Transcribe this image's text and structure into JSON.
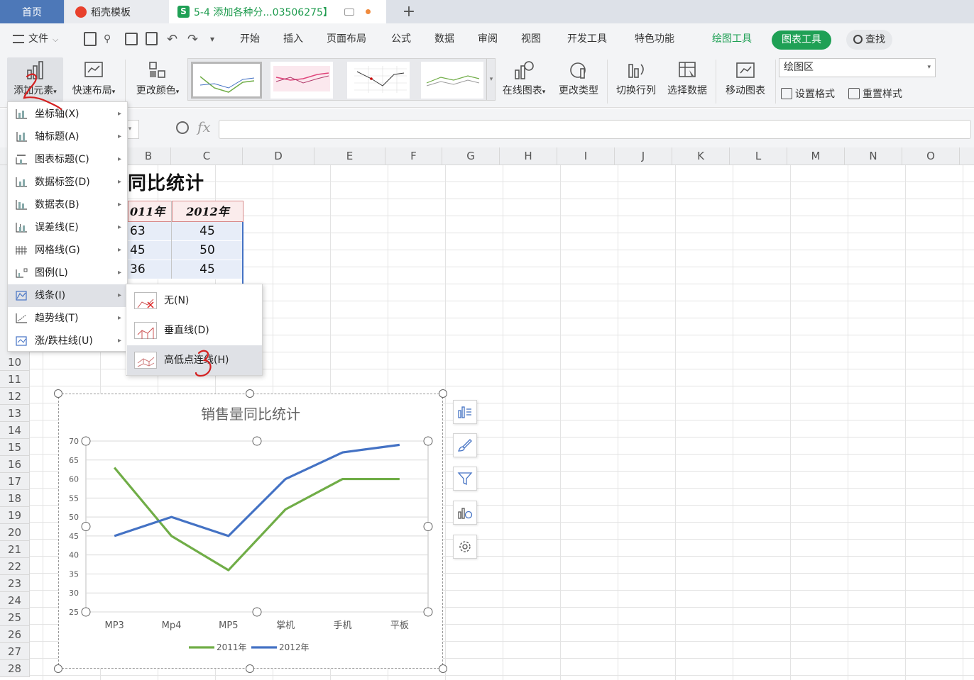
{
  "tabs": {
    "home": "首页",
    "docer": "稻壳模板",
    "file": "5-4 添加各种分...03506275】",
    "file_icon": "S",
    "add": "+"
  },
  "menubar": {
    "file": "文件",
    "items": [
      "开始",
      "插入",
      "页面布局",
      "公式",
      "数据",
      "审阅",
      "视图",
      "开发工具",
      "特色功能"
    ],
    "drawing_tools": "绘图工具",
    "chart_tools": "图表工具",
    "search": "查找"
  },
  "ribbon": {
    "add_element": "添加元素",
    "quick_layout": "快速布局",
    "change_color": "更改颜色",
    "online_chart": "在线图表",
    "change_type": "更改类型",
    "switch_row_col": "切换行列",
    "select_data": "选择数据",
    "move_chart": "移动图表",
    "element_select": "绘图区",
    "set_format": "设置格式",
    "reset_style": "重置样式"
  },
  "formula_bar": {
    "fx": "fx"
  },
  "columns": [
    "B",
    "C",
    "D",
    "E",
    "F",
    "G",
    "H",
    "I",
    "J",
    "K",
    "L",
    "M",
    "N",
    "O"
  ],
  "rows": [
    "10",
    "11",
    "12",
    "13",
    "14",
    "15",
    "16",
    "17",
    "18",
    "19",
    "20",
    "21",
    "22",
    "23",
    "24",
    "25",
    "26",
    "27",
    "28"
  ],
  "sheet": {
    "title": "同比统计",
    "header": [
      "011年",
      "2012年"
    ],
    "rows": [
      [
        "63",
        "45"
      ],
      [
        "45",
        "50"
      ],
      [
        "36",
        "45"
      ]
    ]
  },
  "add_element_menu": [
    {
      "label": "坐标轴(X)"
    },
    {
      "label": "轴标题(A)"
    },
    {
      "label": "图表标题(C)"
    },
    {
      "label": "数据标签(D)"
    },
    {
      "label": "数据表(B)"
    },
    {
      "label": "误差线(E)"
    },
    {
      "label": "网格线(G)"
    },
    {
      "label": "图例(L)"
    },
    {
      "label": "线条(I)"
    },
    {
      "label": "趋势线(T)"
    },
    {
      "label": "涨/跌柱线(U)"
    }
  ],
  "lines_submenu": [
    "无(N)",
    "垂直线(D)",
    "高低点连线(H)"
  ],
  "annotations": {
    "step2": "2",
    "step3": "3",
    "mark": "|"
  },
  "colors": {
    "accent_green": "#1fa055",
    "series_2011": "#70ad47",
    "series_2012": "#4472c4",
    "tab_home": "#4d78b8"
  },
  "chart_data": {
    "type": "line",
    "title": "销售量同比统计",
    "categories": [
      "MP3",
      "Mp4",
      "MP5",
      "掌机",
      "手机",
      "平板"
    ],
    "series": [
      {
        "name": "2011年",
        "values": [
          63,
          45,
          36,
          52,
          60,
          60
        ]
      },
      {
        "name": "2012年",
        "values": [
          45,
          50,
          45,
          60,
          67,
          69
        ]
      }
    ],
    "ylim": [
      25,
      70
    ],
    "yticks": [
      "25",
      "30",
      "35",
      "40",
      "45",
      "50",
      "55",
      "60",
      "65",
      "70"
    ],
    "grid": true,
    "legend": "bottom"
  }
}
